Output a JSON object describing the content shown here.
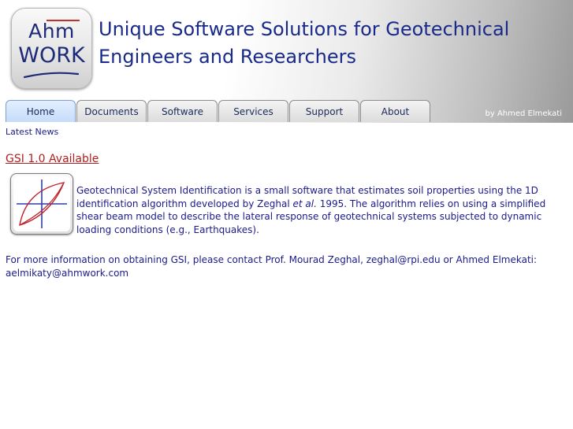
{
  "header": {
    "logo": {
      "top": "Ahm",
      "bottom": "WORK"
    },
    "title_line1": "Unique Software Solutions for Geotechnical",
    "title_line2": "Engineers and Researchers",
    "byline": "by Ahmed Elmekati"
  },
  "nav": {
    "tabs": [
      {
        "label": "Home",
        "active": true
      },
      {
        "label": "Documents",
        "active": false
      },
      {
        "label": "Software",
        "active": false
      },
      {
        "label": "Services",
        "active": false
      },
      {
        "label": "Support",
        "active": false
      },
      {
        "label": "About",
        "active": false
      }
    ]
  },
  "content": {
    "section_label": "Latest News",
    "news": {
      "title": "GSI 1.0 Available",
      "icon": "hysteresis-loop-icon",
      "desc_part1": "Geotechnical System Identification is a small software that estimates soil properties using the 1D identification algorithm developed by Zeghal ",
      "desc_italic": "et al.",
      "desc_part2": " 1995. The algorithm relies on using a simplified shear beam model to describe the lateral response of geotechnical systems subjected to dynamic loading conditions (e.g., Earthquakes)."
    },
    "more_info": "For more information on obtaining GSI, please contact Prof. Mourad Zeghal, zeghal@rpi.edu or Ahmed Elmekati: aelmikaty@ahmwork.com"
  },
  "colors": {
    "title_blue": "#1a2a8a",
    "link_red": "#b01f1f",
    "text_blue": "#1a1a8a"
  }
}
